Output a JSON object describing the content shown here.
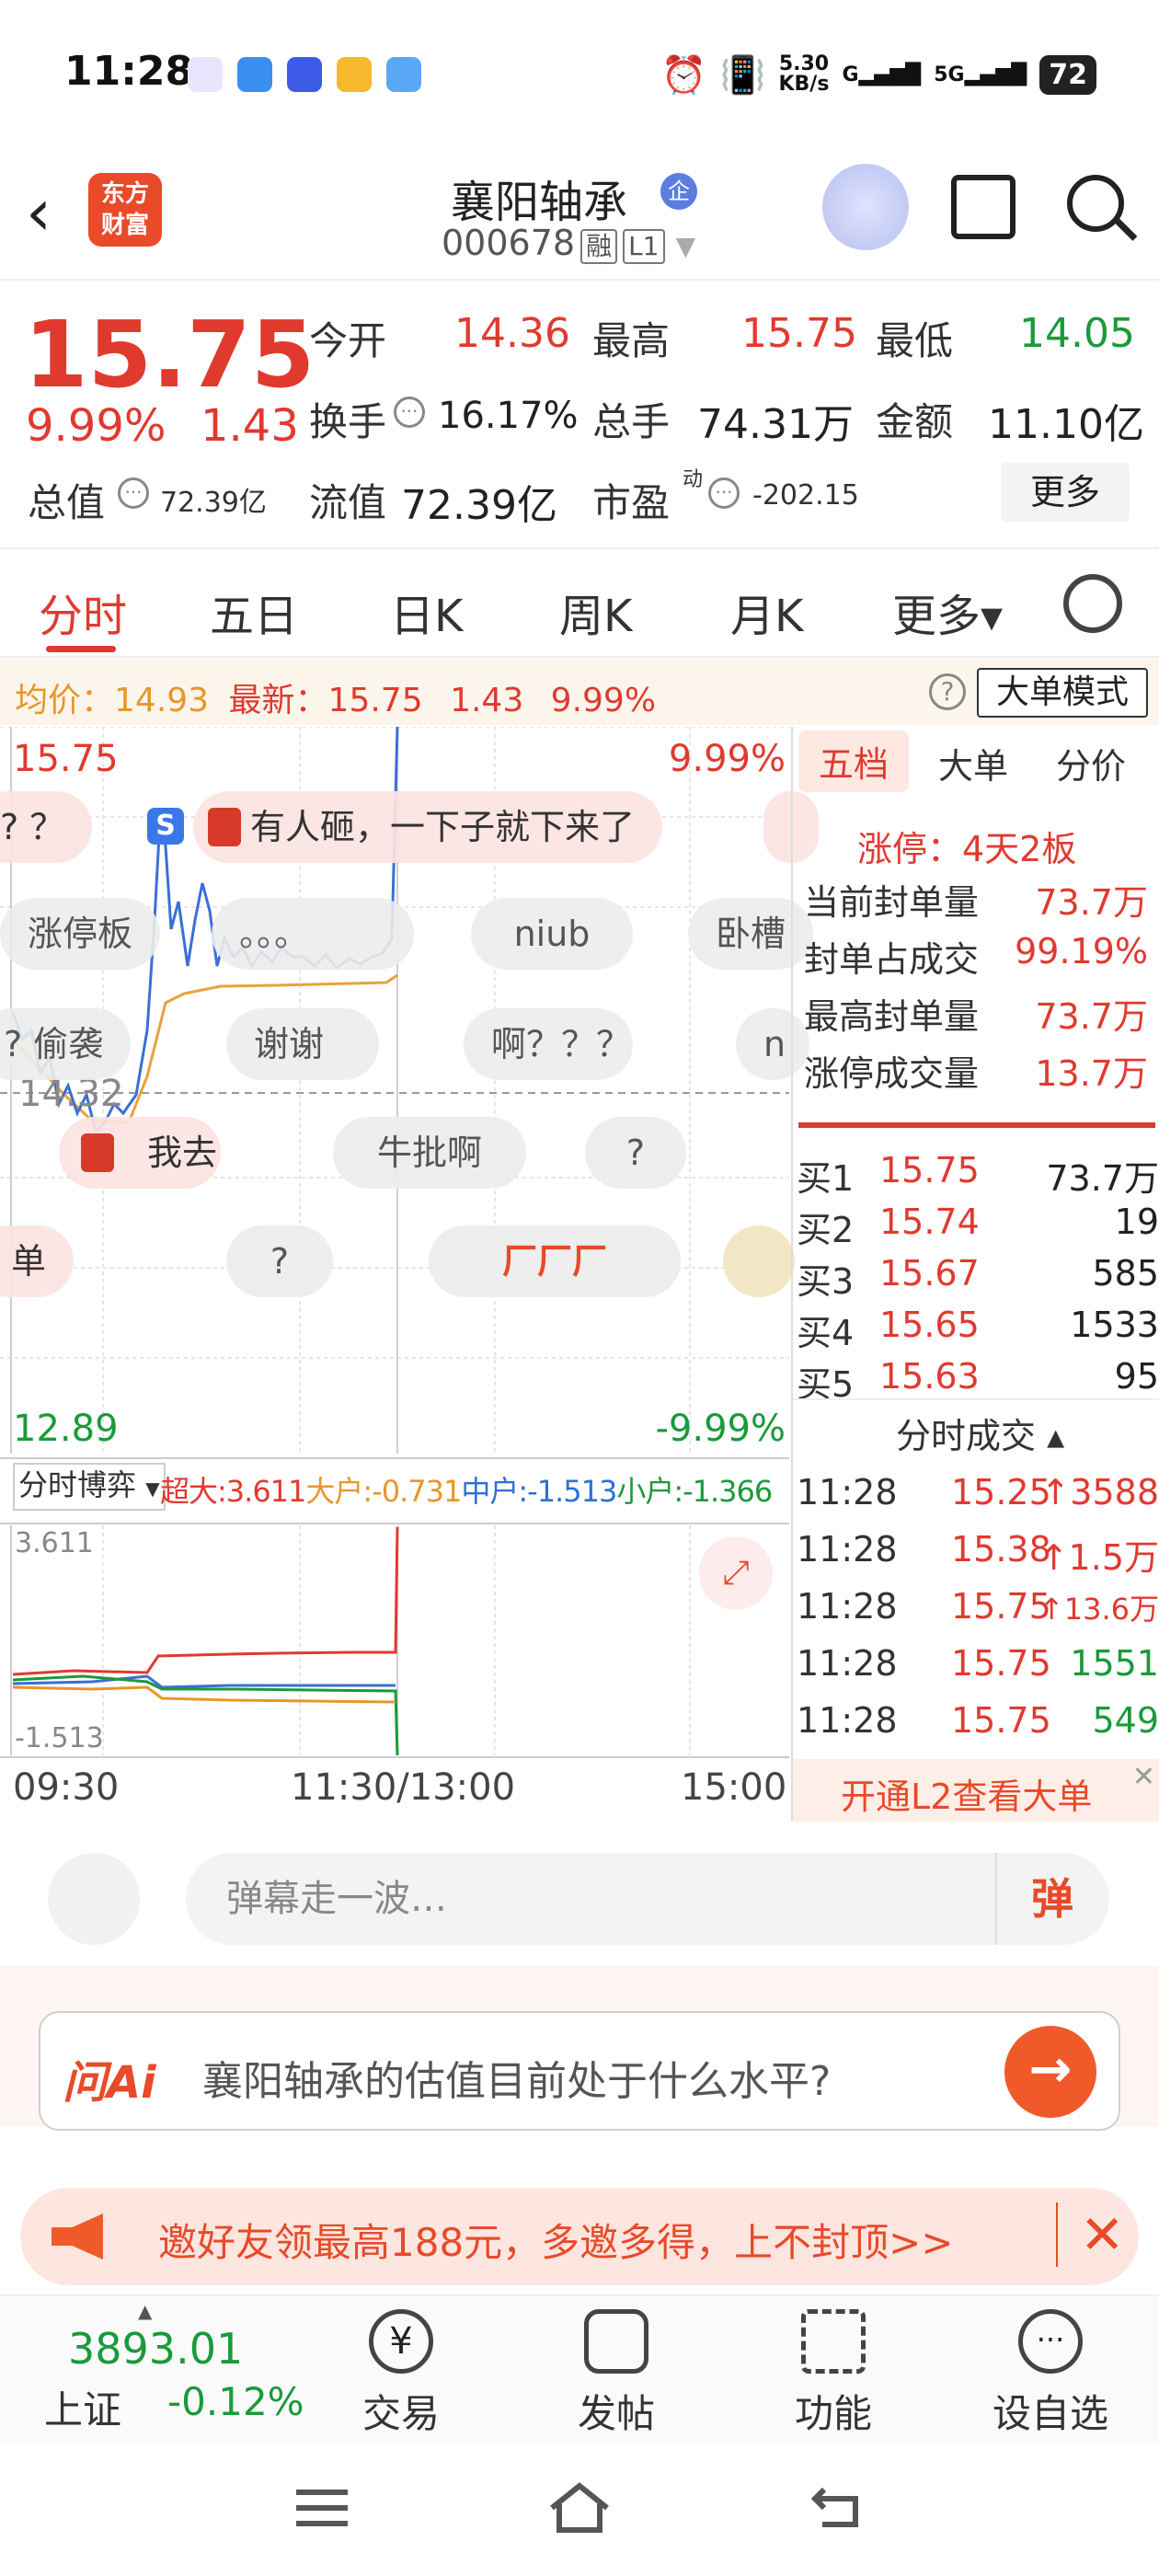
{
  "status": {
    "time": "11:28",
    "net_speed_top": "5.30",
    "net_speed_bottom": "KB/s",
    "signal1": "G",
    "signal2": "5G",
    "battery": "72"
  },
  "header": {
    "name": "襄阳轴承",
    "corp_tag": "企",
    "code": "000678",
    "tag_margin": "融",
    "tag_level": "L1",
    "logo_line1": "东方",
    "logo_line2": "财富"
  },
  "quote": {
    "price": "15.75",
    "pct": "9.99%",
    "chg": "1.43",
    "open_label": "今开",
    "open": "14.36",
    "high_label": "最高",
    "high": "15.75",
    "low_label": "最低",
    "low": "14.05",
    "turnover_label": "换手",
    "turnover": "16.17%",
    "volume_label": "总手",
    "volume": "74.31万",
    "amount_label": "金额",
    "amount": "11.10亿",
    "mcap_label": "总值",
    "mcap": "72.39亿",
    "float_label": "流值",
    "float": "72.39亿",
    "pe_label": "市盈",
    "pe_sup": "动",
    "pe": "-202.15",
    "more": "更多"
  },
  "tabs": {
    "t1": "分时",
    "t2": "五日",
    "t3": "日K",
    "t4": "周K",
    "t5": "月K",
    "t6": "更多▾"
  },
  "avgbar": {
    "avg_label": "均价：",
    "avg": "14.93",
    "latest_label": "最新：",
    "latest": "15.75",
    "chg": "1.43",
    "pct": "9.99%",
    "help": "?",
    "mode": "大单模式"
  },
  "chart": {
    "top_price": "15.75",
    "top_pct": "9.99%",
    "mid_price": "14.32",
    "bottom_price": "12.89",
    "bottom_pct": "-9.99%",
    "flow_selector": "分时博弈",
    "flow_super": "超大:3.611",
    "flow_big": "大户:-0.731",
    "flow_mid": "中户:-1.513",
    "flow_small": "小户:-1.366",
    "flow_max": "3.611",
    "flow_min": "-1.513",
    "time_start": "09:30",
    "time_mid": "11:30/13:00",
    "time_end": "15:00",
    "colors": {
      "price_line": "#3a6fd6",
      "avg_line": "#e8a23a",
      "super": "#e03a2f",
      "big": "#e8962a",
      "mid": "#3a6fd6",
      "small": "#1a9a3a"
    }
  },
  "danmu": {
    "d1": "? ？",
    "d2": "有人砸，一下子就下来了",
    "d3": "涨停板",
    "d4": "。。。",
    "d5": "niub",
    "d6": "卧槽",
    "d7": "? 偷袭",
    "d8": "谢谢",
    "d9": "啊？？？",
    "d10": "n",
    "d11": "我去",
    "d12": "牛批啊",
    "d13": "?",
    "d14": "单",
    "d15": "?",
    "d16": "厂厂厂",
    "s_badge": "S"
  },
  "right_panel": {
    "tab1": "五档",
    "tab2": "大单",
    "tab3": "分价",
    "limit_info": "涨停：4天2板",
    "seal_label": "当前封单量",
    "seal": "73.7万",
    "ratio_label": "封单占成交",
    "ratio": "99.19%",
    "max_seal_label": "最高封单量",
    "max_seal": "73.7万",
    "limit_vol_label": "涨停成交量",
    "limit_vol": "13.7万",
    "bids": [
      {
        "label": "买1",
        "price": "15.75",
        "vol": "73.7万"
      },
      {
        "label": "买2",
        "price": "15.74",
        "vol": "19"
      },
      {
        "label": "买3",
        "price": "15.67",
        "vol": "585"
      },
      {
        "label": "买4",
        "price": "15.65",
        "vol": "1533"
      },
      {
        "label": "买5",
        "price": "15.63",
        "vol": "95"
      }
    ],
    "ticks_title": "分时成交 ▴",
    "ticks": [
      {
        "time": "11:28",
        "price": "15.25",
        "vol": "↑3588"
      },
      {
        "time": "11:28",
        "price": "15.38",
        "vol": "↑1.5万"
      },
      {
        "time": "11:28",
        "price": "15.75",
        "vol": "↑13.6万"
      },
      {
        "time": "11:28",
        "price": "15.75",
        "vol": "1551"
      },
      {
        "time": "11:28",
        "price": "15.75",
        "vol": "549"
      }
    ],
    "l2_banner": "开通L2查看大单"
  },
  "comment": {
    "placeholder": "弹幕走一波…",
    "danmu_btn": "弹"
  },
  "ai": {
    "logo": "问Ai",
    "question": "襄阳轴承的估值目前处于什么水平?",
    "go": "→"
  },
  "promo": {
    "text": "邀好友领最高188元，多邀多得，上不封顶>>",
    "close": "✕"
  },
  "bottom_nav": {
    "index_value": "3893.01",
    "index_name": "上证",
    "index_pct": "-0.12%",
    "n1": "交易",
    "n2": "发帖",
    "n3": "功能",
    "n4": "设自选"
  }
}
